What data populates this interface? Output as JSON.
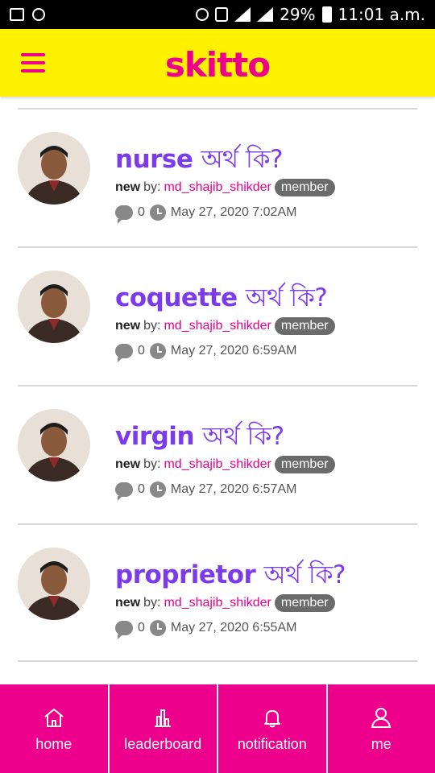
{
  "status_bar": {
    "battery": "29%",
    "time": "11:01 a.m."
  },
  "app": {
    "logo": "skitto"
  },
  "posts": [
    {
      "word": "nurse",
      "suffix": "অর্থ কি?",
      "status": "new",
      "by": "by:",
      "user": "md_shajib_shikder",
      "role": "member",
      "comments": "0",
      "date": "May 27, 2020 7:02AM"
    },
    {
      "word": "coquette",
      "suffix": "অর্থ কি?",
      "status": "new",
      "by": "by:",
      "user": "md_shajib_shikder",
      "role": "member",
      "comments": "0",
      "date": "May 27, 2020 6:59AM"
    },
    {
      "word": "virgin",
      "suffix": "অর্থ কি?",
      "status": "new",
      "by": "by:",
      "user": "md_shajib_shikder",
      "role": "member",
      "comments": "0",
      "date": "May 27, 2020 6:57AM"
    },
    {
      "word": "proprietor",
      "suffix": "অর্থ কি?",
      "status": "new",
      "by": "by:",
      "user": "md_shajib_shikder",
      "role": "member",
      "comments": "0",
      "date": "May 27, 2020 6:55AM"
    }
  ],
  "nav": {
    "home": "home",
    "leaderboard": "leaderboard",
    "notification": "notification",
    "me": "me"
  },
  "colors": {
    "brand": "#ec008c",
    "header": "#fff200",
    "title": "#7c3aed"
  }
}
